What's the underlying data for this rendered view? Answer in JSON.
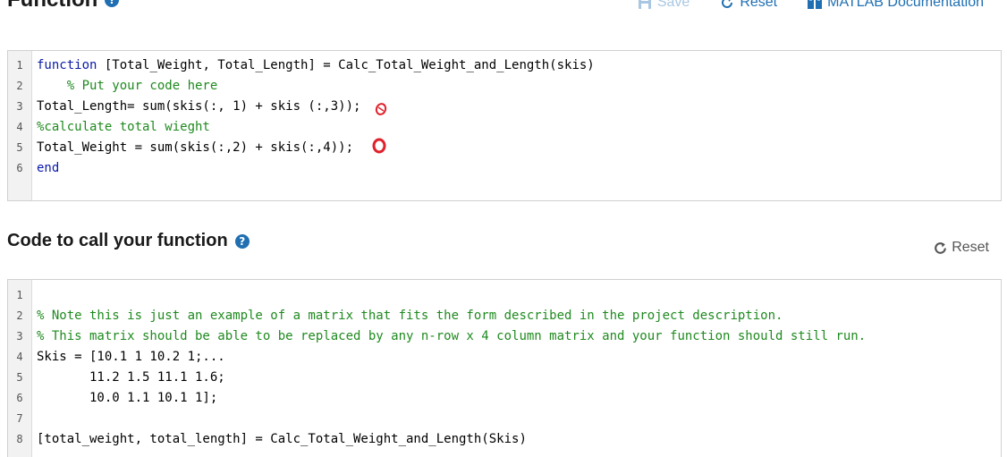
{
  "function_section": {
    "title": "Function",
    "toolbar": {
      "save": "Save",
      "reset": "Reset",
      "docs": "MATLAB Documentation"
    },
    "lines": [
      {
        "num": "1",
        "parts": [
          {
            "t": "function",
            "c": "kw"
          },
          {
            "t": " [Total_Weight, Total_Length] = Calc_Total_Weight_and_Length(skis)",
            "c": ""
          }
        ]
      },
      {
        "num": "2",
        "parts": [
          {
            "t": "    % Put your code here",
            "c": "cm"
          }
        ]
      },
      {
        "num": "3",
        "parts": [
          {
            "t": "Total_Length= sum(skis(:, 1) + skis (:,3));",
            "c": ""
          }
        ]
      },
      {
        "num": "4",
        "parts": [
          {
            "t": "%calculate total wieght",
            "c": "cm"
          }
        ]
      },
      {
        "num": "5",
        "parts": [
          {
            "t": "Total_Weight = sum(skis(:,2) + skis(:,4));",
            "c": ""
          }
        ]
      },
      {
        "num": "6",
        "parts": [
          {
            "t": "end",
            "c": "kw"
          }
        ]
      }
    ]
  },
  "call_section": {
    "title": "Code to call your function",
    "reset": "Reset",
    "lines": [
      {
        "num": "1",
        "parts": []
      },
      {
        "num": "2",
        "parts": [
          {
            "t": "% Note this is just an example of a matrix that fits the form described in the project description.",
            "c": "cm"
          }
        ]
      },
      {
        "num": "3",
        "parts": [
          {
            "t": "% This matrix should be able to be replaced by any n-row x 4 column matrix and your function should still run.",
            "c": "cm"
          }
        ]
      },
      {
        "num": "4",
        "parts": [
          {
            "t": "Skis = [10.1 1 10.2 1;...",
            "c": ""
          }
        ]
      },
      {
        "num": "5",
        "parts": [
          {
            "t": "       11.2 1.5 11.1 1.6;",
            "c": ""
          }
        ]
      },
      {
        "num": "6",
        "parts": [
          {
            "t": "       10.0 1.1 10.1 1];",
            "c": ""
          }
        ]
      },
      {
        "num": "7",
        "parts": []
      },
      {
        "num": "8",
        "parts": [
          {
            "t": "[total_weight, total_length] = Calc_Total_Weight_and_Length(Skis)",
            "c": ""
          }
        ]
      }
    ]
  },
  "icons": {
    "help": "help-circle-icon",
    "save": "floppy-disk-icon",
    "reset": "refresh-icon",
    "docs": "book-icon"
  },
  "colors": {
    "link": "#1f6fb2",
    "keyword": "#0b1aa8",
    "comment": "#1f8a1f",
    "annotation": "#e0202a"
  }
}
